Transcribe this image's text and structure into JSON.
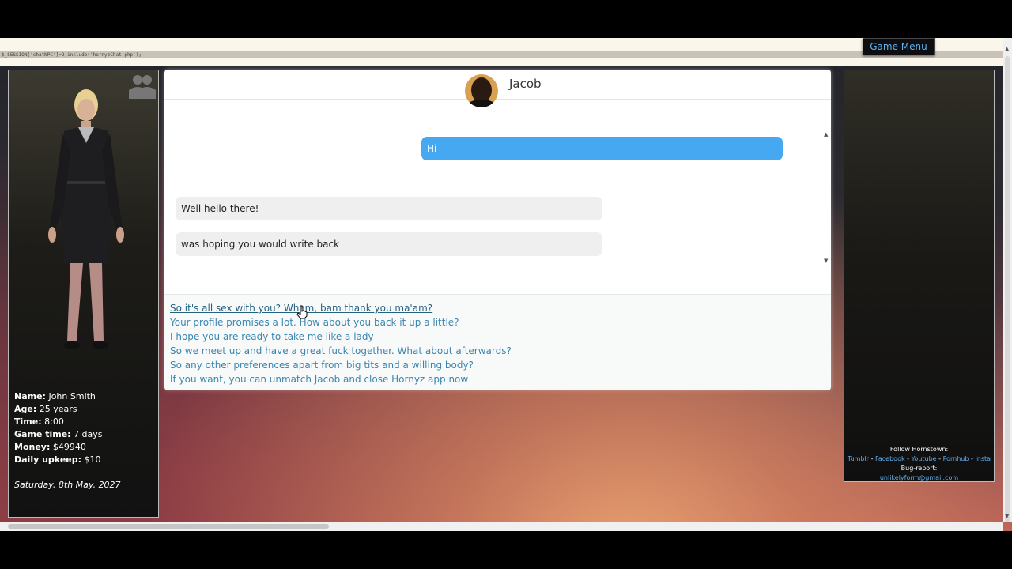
{
  "debug_text": "$_SESSION['chatNPC']=2;include('hornyzChat.php');",
  "game_menu": "Game Menu",
  "player": {
    "stats": [
      {
        "label": "Name:",
        "value": "John Smith"
      },
      {
        "label": "Age:",
        "value": "25 years"
      },
      {
        "label": "Time:",
        "value": "8:00"
      },
      {
        "label": "Game time:",
        "value": "7 days"
      },
      {
        "label": "Money:",
        "value": "$49940"
      },
      {
        "label": "Daily upkeep:",
        "value": "$10"
      }
    ],
    "date": "Saturday, 8th May, 2027"
  },
  "chat": {
    "contact_name": "Jacob",
    "messages": [
      {
        "from": "player",
        "text": "Hi"
      },
      {
        "from": "npc",
        "text": "Well hello there!"
      },
      {
        "from": "npc",
        "text": "was hoping you would write back"
      }
    ],
    "options": [
      "So it's all sex with you? Wham, bam thank you ma'am?",
      "Your profile promises a lot. How about you back it up a little?",
      "I hope you are ready to take me like a lady",
      "So we meet up and have a great fuck together. What about afterwards?",
      "So any other preferences apart from big tits and a willing body?",
      "If you want, you can unmatch Jacob and close Hornyz app now"
    ]
  },
  "footer": {
    "follow_label": "Follow Hornstown:",
    "links": [
      "Tumblr",
      "Facebook",
      "Youtube",
      "Pornhub",
      "Insta"
    ],
    "bug_label": "Bug-report:",
    "bug_email": "unlikelyform@gmail.com"
  },
  "colors": {
    "outgoing_bubble": "#45a8f0",
    "incoming_bubble": "#efefef",
    "option_link": "#3a86b0",
    "menu_text": "#5fb2f0"
  }
}
